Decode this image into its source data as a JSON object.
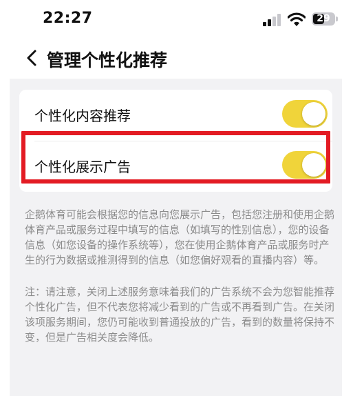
{
  "status_bar": {
    "time": "22:27",
    "battery": "29",
    "icons": [
      "cellular-signal-icon",
      "wifi-icon",
      "battery-icon"
    ]
  },
  "header": {
    "back_icon": "chevron-left-icon",
    "title": "管理个性化推荐"
  },
  "settings": [
    {
      "label": "个性化内容推荐",
      "enabled": true
    },
    {
      "label": "个性化展示广告",
      "enabled": true,
      "highlighted": true
    }
  ],
  "notes": {
    "paragraph1": "企鹅体育可能会根据您的信息向您展示广告，包括您注册和使用企鹅体育产品或服务过程中填写的信息（如填写的性别信息），您的设备信息（如您设备的操作系统等），您在使用企鹅体育产品或服务时产生的行为数据或推测得到的信息（如您偏好观看的直播内容）等。",
    "paragraph2": "注：请注意，关闭上述服务意味着我们的广告系统不会为您智能推荐个性化广告，但不代表您将减少看到的广告或不再看到广告。在关闭该项服务期间，您仍可能收到普通投放的广告，看到的数量将保持不变，但是广告相关度会降低。"
  },
  "colors": {
    "toggle_on": "#f0d43a",
    "highlight_border": "#e31b23",
    "background": "#f2f2f4",
    "note_text": "#8b8b8b"
  }
}
